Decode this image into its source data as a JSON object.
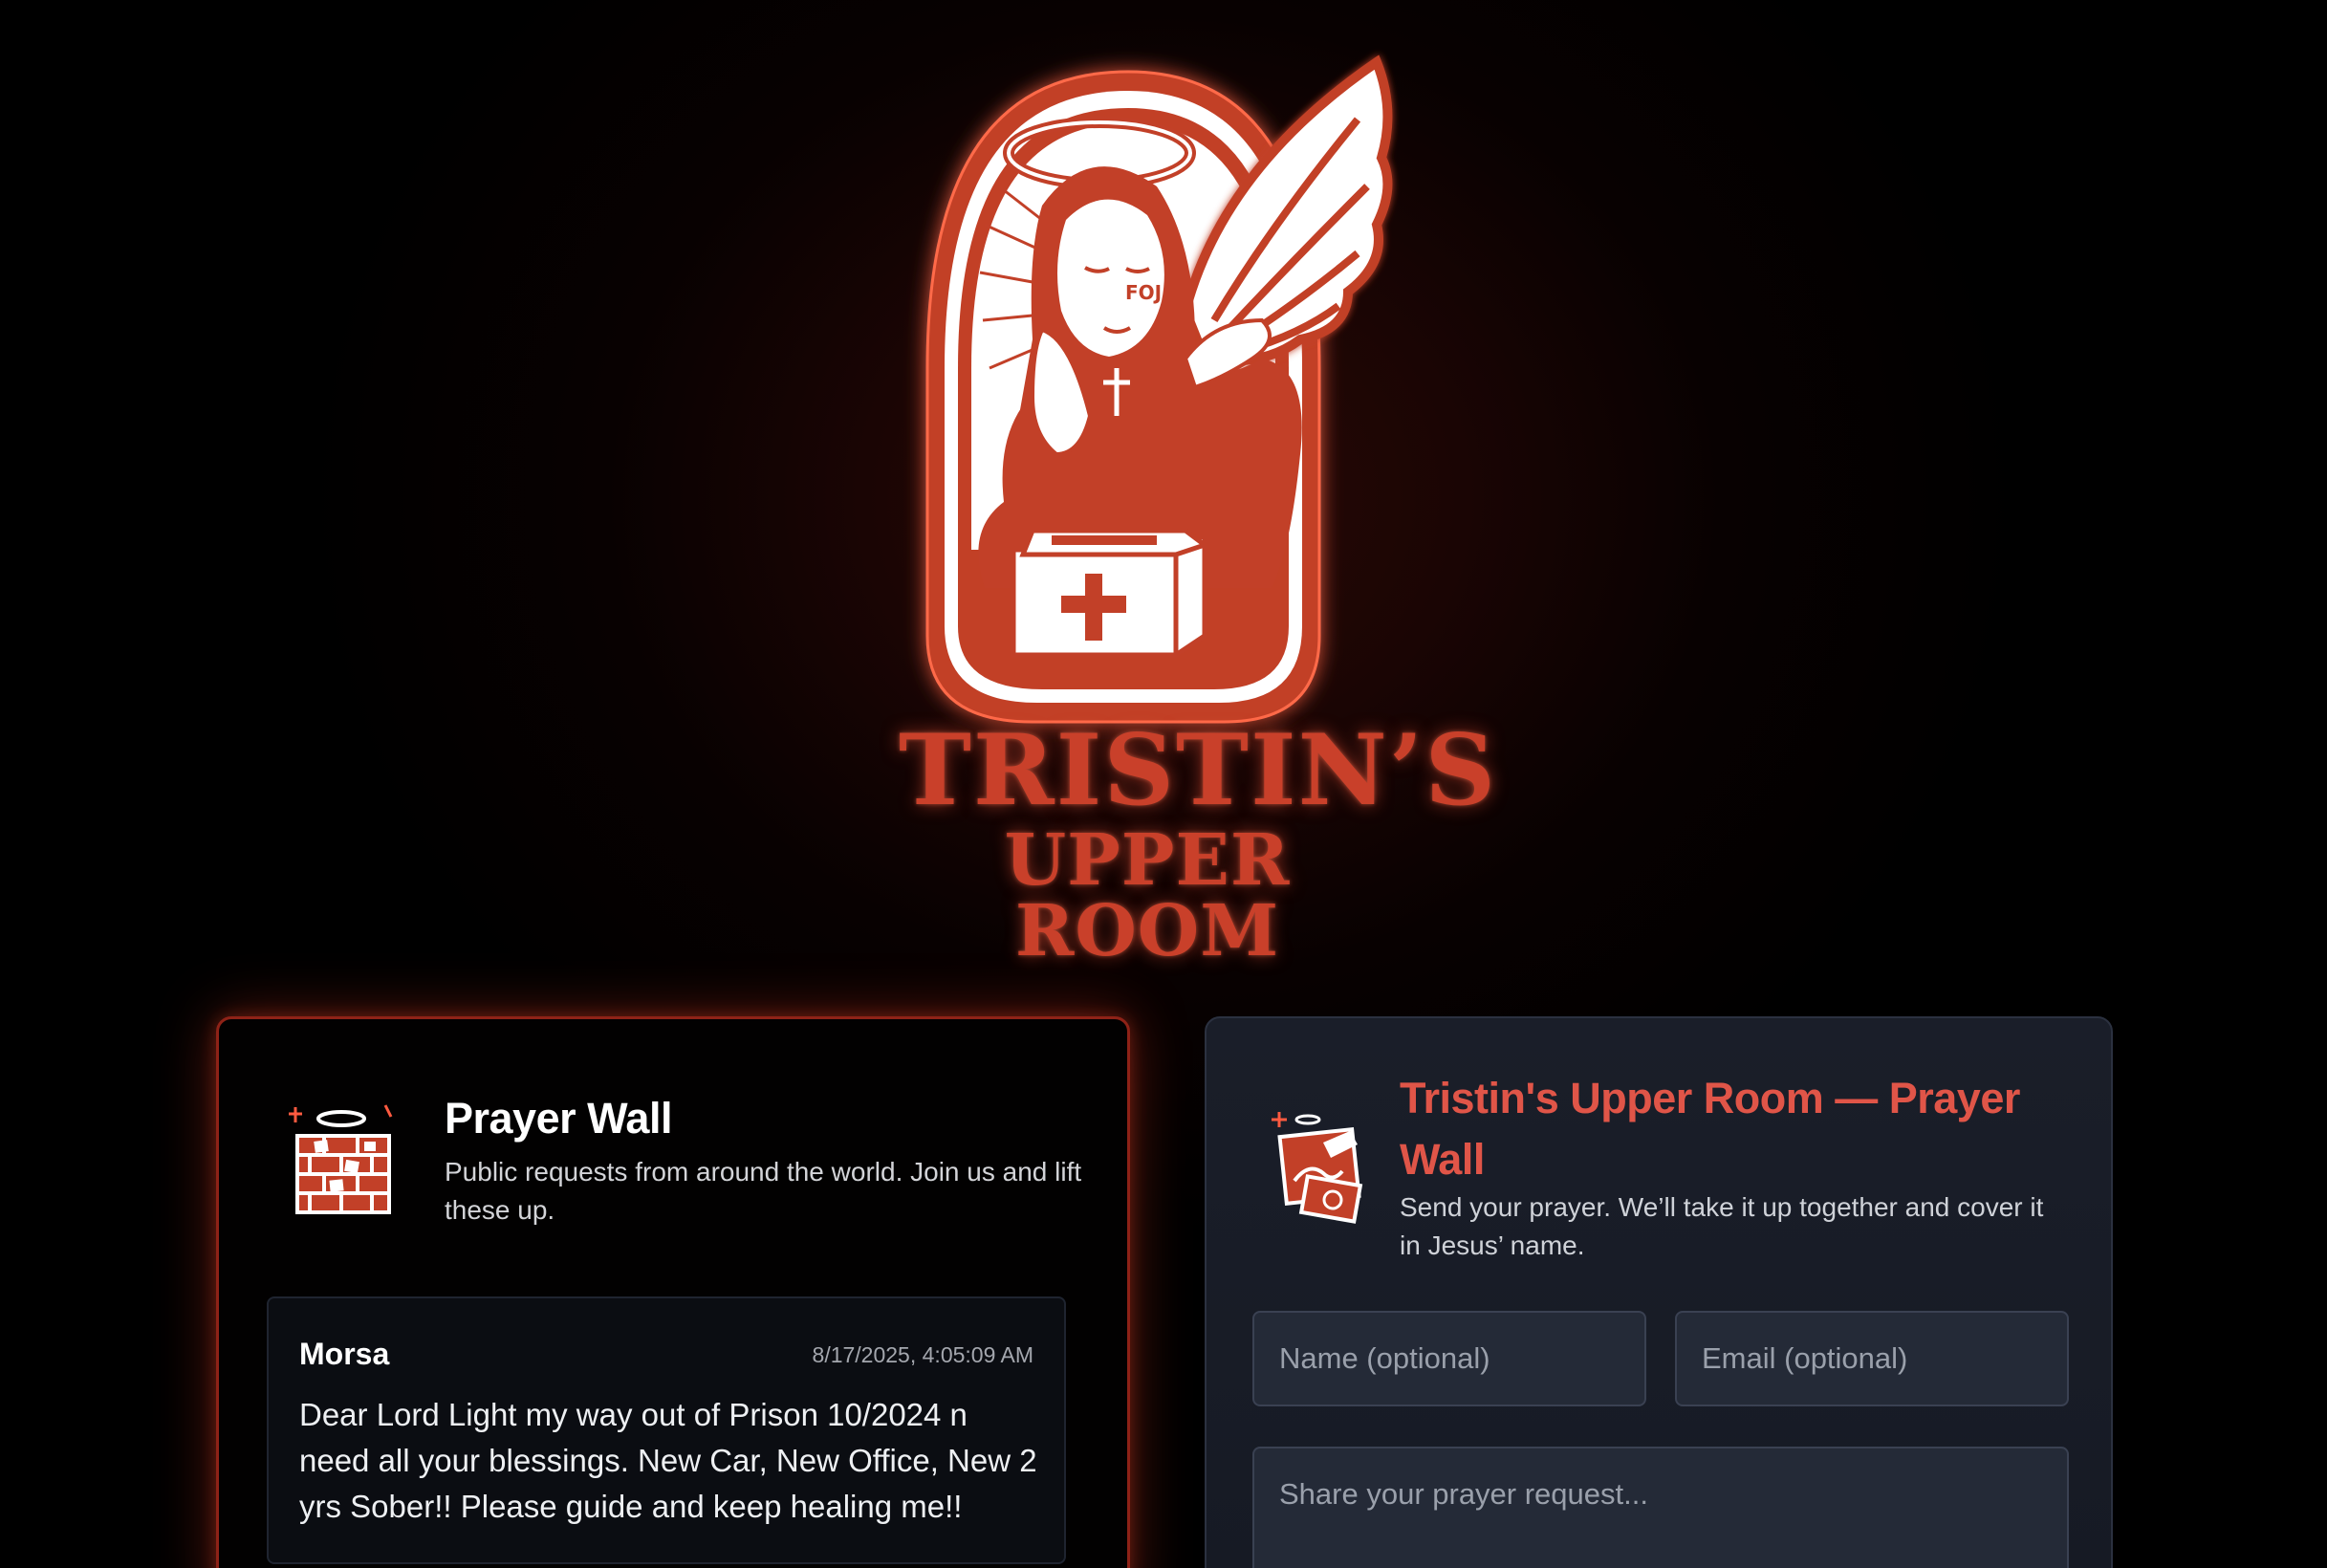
{
  "brand": {
    "line1": "TRISTIN’S",
    "line2": "UPPER ROOM",
    "primary_color": "#c9402a",
    "logo_icon": "praying-angel-logo",
    "logo_tattoo_text": "FOJ"
  },
  "prayer_wall": {
    "icon": "prayer-wall-bricks-icon",
    "title": "Prayer Wall",
    "subtitle": "Public requests from around the world. Join us and lift these up.",
    "requests": [
      {
        "name": "Morsa",
        "timestamp": "8/17/2025, 4:05:09 AM",
        "body": "Dear Lord Light my way out of Prison 10/2024 n need all your blessings. New Car, New Office, New 2 yrs Sober!! Please guide and keep healing me!!"
      }
    ]
  },
  "prayer_form": {
    "icon": "prayer-note-icon",
    "title": "Tristin's Upper Room — Prayer Wall",
    "subtitle": "Send your prayer. We’ll take it up together and cover it in Jesus’ name.",
    "name_placeholder": "Name (optional)",
    "email_placeholder": "Email (optional)",
    "message_placeholder": "Share your prayer request...",
    "accent_color": "#e05548"
  }
}
